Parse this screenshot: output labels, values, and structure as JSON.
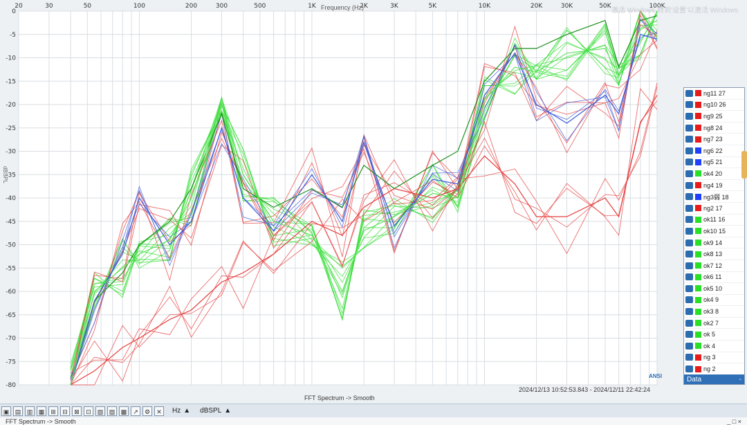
{
  "window": {
    "caption": "FFT Spectrum -> Smooth",
    "timestamp": "2024/12/13 10:52:53.843 - 2024/12/11 22:42:24",
    "ansi_label": "ANSI",
    "watermark": "激活 Windows 转到'设置'以激活 Windows",
    "status_left": "FFT Spectrum -> Smooth",
    "status_right": "_ □ ×"
  },
  "toolbar": {
    "items": [
      "▣",
      "▤",
      "▥",
      "▦",
      "⊞",
      "⊟",
      "⊠",
      "⊡",
      "▧",
      "▨",
      "▩",
      "↗",
      "⚙",
      "✕"
    ],
    "unit_x": "Hz",
    "unit_y": "dBSPL",
    "unit_y_arrow": "▲",
    "unit_x_arrow": "▲"
  },
  "legend": {
    "footer_left": "Data",
    "footer_right": "-",
    "items": [
      {
        "label": "ng11 27",
        "color": "#e61b1b"
      },
      {
        "label": "ng10 26",
        "color": "#e61b1b"
      },
      {
        "label": "ng9 25",
        "color": "#e61b1b"
      },
      {
        "label": "ng8 24",
        "color": "#e61b1b"
      },
      {
        "label": "ng7 23",
        "color": "#e61b1b"
      },
      {
        "label": "ng6 22",
        "color": "#1f3fff"
      },
      {
        "label": "ng5 21",
        "color": "#1f3fff"
      },
      {
        "label": "ok4 20",
        "color": "#28e028"
      },
      {
        "label": "ng4 19",
        "color": "#e61b1b"
      },
      {
        "label": "ng3弱 18",
        "color": "#1f3fff"
      },
      {
        "label": "ng2 17",
        "color": "#e61b1b"
      },
      {
        "label": "ok11 16",
        "color": "#28e028"
      },
      {
        "label": "ok10 15",
        "color": "#28e028"
      },
      {
        "label": "ok9 14",
        "color": "#28e028"
      },
      {
        "label": "ok8 13",
        "color": "#28e028"
      },
      {
        "label": "ok7 12",
        "color": "#28e028"
      },
      {
        "label": "ok6 11",
        "color": "#28e028"
      },
      {
        "label": "ok5 10",
        "color": "#28e028"
      },
      {
        "label": "ok4 9",
        "color": "#28e028"
      },
      {
        "label": "ok3 8",
        "color": "#28e028"
      },
      {
        "label": "ok2 7",
        "color": "#28e028"
      },
      {
        "label": "ok 5",
        "color": "#28e028"
      },
      {
        "label": "ok 4",
        "color": "#28e028"
      },
      {
        "label": "ng 3",
        "color": "#e61b1b"
      },
      {
        "label": "ng 2",
        "color": "#e61b1b"
      },
      {
        "label": "ng",
        "color": "#e61b1b"
      }
    ]
  },
  "chart_data": {
    "type": "line",
    "title": "",
    "xlabel": "Frequency (Hz)",
    "ylabel": "dBSPL",
    "x_scale": "log",
    "xlim": [
      20,
      100000
    ],
    "ylim": [
      -80,
      0
    ],
    "x_ticks": [
      20,
      30,
      50,
      100,
      200,
      300,
      500,
      1000,
      2000,
      3000,
      5000,
      10000,
      20000,
      30000,
      50000,
      100000
    ],
    "x_tick_labels": [
      "20",
      "30",
      "50",
      "100",
      "200",
      "300",
      "500",
      "1K",
      "2K",
      "3K",
      "5K",
      "10K",
      "20K",
      "30K",
      "50K",
      "100K"
    ],
    "y_ticks": [
      0,
      -5,
      -10,
      -15,
      -20,
      -25,
      -30,
      -35,
      -40,
      -45,
      -50,
      -55,
      -60,
      -65,
      -70,
      -75,
      -80
    ],
    "y_tick_labels": [
      "0",
      "-5",
      "-10",
      "-15",
      "-20",
      "-25",
      "-30",
      "-35",
      "-40",
      "-45",
      "-50",
      "-55",
      "-60",
      "-65",
      "-70",
      "-75",
      "-80"
    ],
    "grid": true,
    "series_groups": {
      "green": {
        "color": "#2fdc2f",
        "count": 12
      },
      "red": {
        "color": "#e53b3b",
        "count": 9
      },
      "blue": {
        "color": "#3c5bd8",
        "count": 3
      }
    },
    "representative": [
      {
        "name": "ok4 20",
        "color": "#1d8f1d",
        "x": [
          40,
          55,
          80,
          100,
          150,
          200,
          300,
          400,
          600,
          1000,
          1500,
          2000,
          3000,
          5000,
          7000,
          10000,
          15000,
          20000,
          30000,
          50000,
          60000,
          80000,
          100000
        ],
        "y": [
          -80,
          -62,
          -56,
          -50,
          -45,
          -38,
          -22,
          -38,
          -42,
          -38,
          -42,
          -33,
          -38,
          -33,
          -30,
          -15,
          -8,
          -8,
          -5,
          -2,
          -12,
          -2,
          -1
        ]
      },
      {
        "name": "ng5 21",
        "color": "#3c5bd8",
        "x": [
          40,
          55,
          80,
          100,
          150,
          200,
          300,
          400,
          600,
          1000,
          1500,
          2000,
          3000,
          5000,
          7000,
          10000,
          15000,
          20000,
          30000,
          50000,
          60000,
          80000,
          100000
        ],
        "y": [
          -80,
          -62,
          -52,
          -40,
          -50,
          -45,
          -25,
          -40,
          -47,
          -35,
          -45,
          -28,
          -46,
          -36,
          -37,
          -18,
          -9,
          -20,
          -24,
          -18,
          -22,
          -5,
          -6
        ]
      },
      {
        "name": "ng 2",
        "color": "#e53b3b",
        "x": [
          40,
          55,
          80,
          100,
          150,
          200,
          300,
          400,
          600,
          1000,
          1500,
          2000,
          3000,
          5000,
          7000,
          10000,
          15000,
          20000,
          30000,
          50000,
          60000,
          80000,
          100000
        ],
        "y": [
          -80,
          -77,
          -72,
          -70,
          -66,
          -64,
          -58,
          -56,
          -52,
          -45,
          -48,
          -42,
          -38,
          -40,
          -38,
          -31,
          -37,
          -44,
          -44,
          -40,
          -44,
          -24,
          -18
        ]
      },
      {
        "name": "ok6 11",
        "color": "#61e161",
        "x": [
          40,
          55,
          80,
          100,
          150,
          200,
          300,
          400,
          600,
          1000,
          1500,
          2000,
          3000,
          5000,
          7000,
          10000,
          15000,
          20000,
          30000,
          50000,
          60000,
          80000,
          100000
        ],
        "y": [
          -80,
          -60,
          -55,
          -52,
          -49,
          -40,
          -20,
          -35,
          -45,
          -48,
          -60,
          -47,
          -44,
          -39,
          -40,
          -19,
          -12,
          -13,
          -9,
          -8,
          -14,
          -4,
          -2
        ]
      }
    ]
  }
}
